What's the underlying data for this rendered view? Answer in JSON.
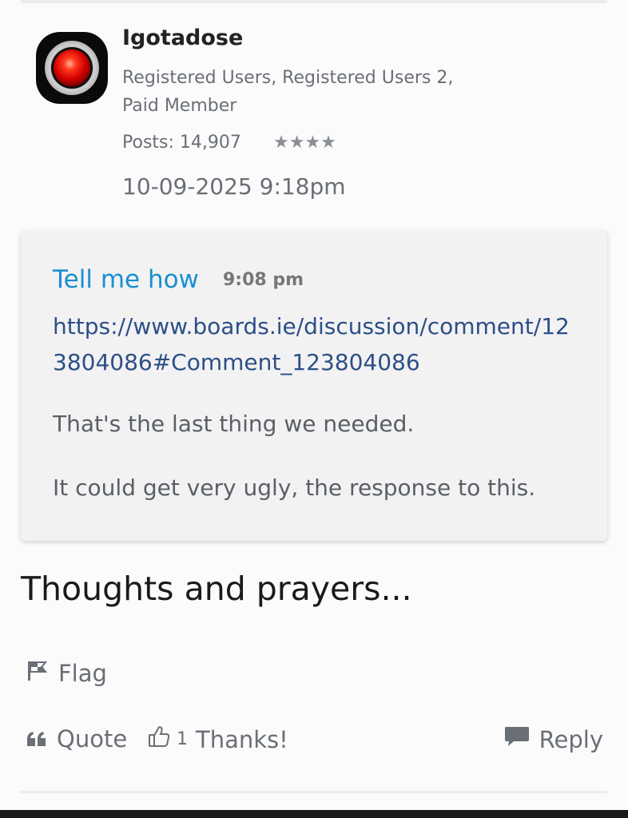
{
  "post": {
    "username": "Igotadose",
    "roles": "Registered Users, Registered Users 2, Paid Member",
    "posts": "Posts: 14,907",
    "stars": "★★★★",
    "date": "10-09-2025 9:18pm"
  },
  "quote": {
    "author": "Tell me how",
    "time": "9:08 pm",
    "link": "https://www.boards.ie/discussion/comment/123804086#Comment_123804086",
    "paragraph1": "That's the last thing we needed.",
    "paragraph2": "It could get very ugly, the response to this."
  },
  "body": {
    "text": "Thoughts and prayers..."
  },
  "actions": {
    "flag_label": "Flag",
    "quote_label": "Quote",
    "thanks_count": "1",
    "thanks_label": "Thanks!",
    "reply_label": "Reply"
  },
  "icons": {
    "flag": "flag-icon",
    "quote": "quote-icon",
    "thanks": "thumbs-up-icon",
    "reply": "speech-bubble-icon"
  },
  "colors": {
    "link_blue": "#1a8fd0",
    "url_blue": "#2d4f86",
    "quote_bg": "#f2f2f3"
  }
}
